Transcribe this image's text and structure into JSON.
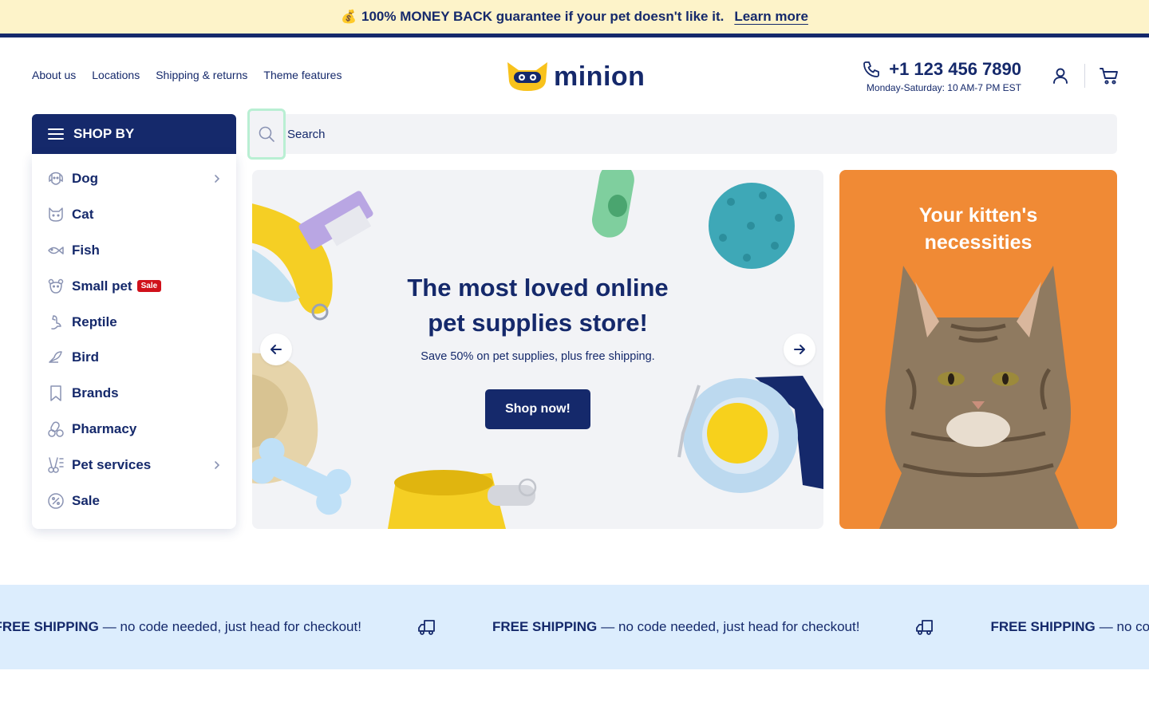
{
  "announcement": {
    "emoji": "💰",
    "text": "100% MONEY BACK guarantee if your pet doesn't like it.",
    "link": "Learn more"
  },
  "topnav": [
    "About us",
    "Locations",
    "Shipping & returns",
    "Theme features"
  ],
  "logo": {
    "wordmark": "minion"
  },
  "contact": {
    "phone": "+1 123 456 7890",
    "hours": "Monday-Saturday: 10 AM-7 PM EST"
  },
  "shopby": {
    "title": "SHOP BY",
    "items": [
      {
        "label": "Dog",
        "icon": "dog-icon",
        "submenu": true
      },
      {
        "label": "Cat",
        "icon": "cat-icon"
      },
      {
        "label": "Fish",
        "icon": "fish-icon"
      },
      {
        "label": "Small pet",
        "icon": "small-pet-icon",
        "badge": "Sale"
      },
      {
        "label": "Reptile",
        "icon": "reptile-icon"
      },
      {
        "label": "Bird",
        "icon": "bird-icon"
      },
      {
        "label": "Brands",
        "icon": "bookmark-icon"
      },
      {
        "label": "Pharmacy",
        "icon": "pharmacy-icon"
      },
      {
        "label": "Pet services",
        "icon": "scissors-icon",
        "submenu": true
      },
      {
        "label": "Sale",
        "icon": "percent-icon"
      }
    ]
  },
  "search": {
    "placeholder": "Search"
  },
  "hero": {
    "title_line1": "The most loved online",
    "title_line2": "pet supplies store!",
    "subtitle": "Save 50% on pet supplies, plus free shipping.",
    "cta": "Shop now!"
  },
  "promo": {
    "title_line1": "Your kitten's",
    "title_line2": "necessities"
  },
  "shipping": {
    "bold": "FREE SHIPPING",
    "rest": "— no code needed, just head for checkout!"
  },
  "colors": {
    "navy": "#15296b",
    "announce_bg": "#fdf3c9",
    "promo_orange": "#f08a35",
    "marquee_bg": "#dcedfd",
    "sale_red": "#d0111b"
  }
}
